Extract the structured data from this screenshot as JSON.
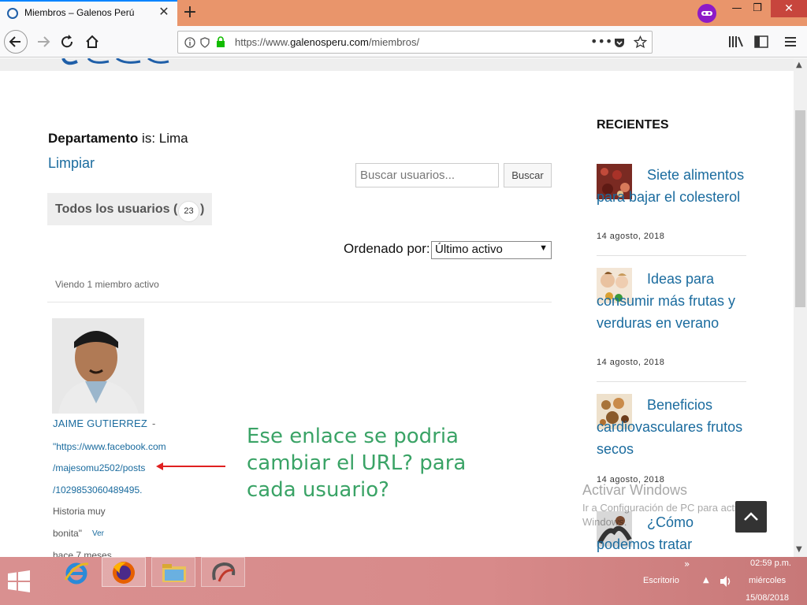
{
  "browser": {
    "tab_title": "Miembros – Galenos Perú",
    "url_prefix": "https://www.",
    "url_host": "galenosperu.com",
    "url_path": "/miembros/",
    "new_tab": "+",
    "close_tab": "✕"
  },
  "page": {
    "filter_label": "Departamento",
    "filter_is": " is: Lima",
    "clear_link": "Limpiar",
    "search_placeholder": "Buscar usuarios...",
    "search_button": "Buscar",
    "all_users_label": "Todos los usuarios (",
    "all_users_count": "23",
    "close_paren": ")",
    "order_label": "Ordenado por:",
    "order_value": "Último activo",
    "viewing": "Viendo 1 miembro activo"
  },
  "member": {
    "name": "JAIME GUTIERREZ",
    "dash": "-",
    "bio_line1": "\"https://www.facebook.com",
    "bio_line2": "/majesomu2502/posts",
    "bio_line3": "/1029853060489495.",
    "bio_line4": "Historia muy",
    "bio_line5": "bonita\"",
    "bio_more": "Ver",
    "bio_cut": "hace 7 meses"
  },
  "annotation": "Ese enlace se podria cambiar el URL? para cada usuario?",
  "sidebar": {
    "heading": "RECIENTES",
    "posts": [
      {
        "title": "Siete alimentos para bajar el colesterol",
        "date": "14 agosto, 2018"
      },
      {
        "title": "Ideas para consumir más frutas y verduras en verano",
        "date": "14 agosto, 2018"
      },
      {
        "title": "Beneficios cardiovasculares frutos secos",
        "date": "14 agosto, 2018"
      },
      {
        "title": "¿Cómo podemos tratar",
        "date": ""
      }
    ]
  },
  "watermark": {
    "line1": "Activar Windows",
    "line2": "Ir a Configuración de PC para activar",
    "line3": "Windows."
  },
  "taskbar": {
    "tray_label": "Escritorio",
    "time": "02:59 p.m.",
    "day": "miércoles",
    "date": "15/08/2018"
  },
  "colors": {
    "accent_link": "#1a6b9e",
    "annotation": "#3aa366",
    "tabbar": "#e9956b",
    "taskbar": "#d88a8a"
  }
}
